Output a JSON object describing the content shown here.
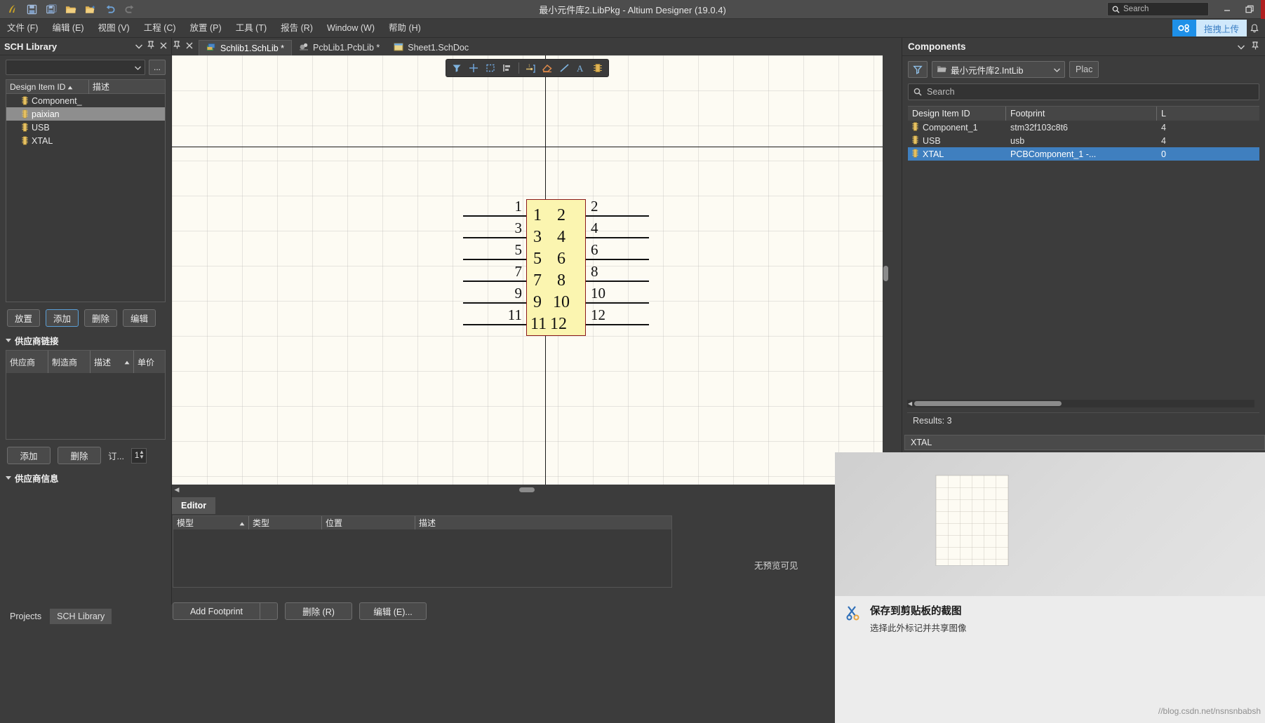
{
  "titlebar": {
    "title": "最小元件库2.LibPkg - Altium Designer (19.0.4)",
    "search_placeholder": "Search",
    "quick_access": [
      "altium-logo",
      "save-icon",
      "save-all-icon",
      "open-icon",
      "open-project-icon",
      "undo-icon",
      "redo-icon"
    ],
    "window_buttons": [
      "minimize",
      "restore",
      "close"
    ]
  },
  "menubar": {
    "items": [
      {
        "label": "文件 (F)"
      },
      {
        "label": "编辑 (E)"
      },
      {
        "label": "视图 (V)"
      },
      {
        "label": "工程 (C)"
      },
      {
        "label": "放置 (P)"
      },
      {
        "label": "工具 (T)"
      },
      {
        "label": "报告 (R)"
      },
      {
        "label": "Window (W)"
      },
      {
        "label": "帮助 (H)"
      }
    ],
    "upload_label": "拖拽上传"
  },
  "left_panel": {
    "title": "SCH Library",
    "library_combo_value": "",
    "dots_label": "...",
    "list_headers": {
      "col1": "Design Item ID",
      "col2": "描述"
    },
    "items": [
      {
        "label": "Component_",
        "selected": false
      },
      {
        "label": "paixian",
        "selected": true
      },
      {
        "label": "USB",
        "selected": false
      },
      {
        "label": "XTAL",
        "selected": false
      }
    ],
    "buttons": [
      {
        "label": "放置",
        "focus": false
      },
      {
        "label": "添加",
        "focus": true
      },
      {
        "label": "删除",
        "focus": false
      },
      {
        "label": "编辑",
        "focus": false
      }
    ],
    "supplier_links": {
      "title": "供应商链接",
      "headers": [
        "供应商",
        "制造商",
        "描述",
        "单价"
      ],
      "rows": []
    },
    "supplier_buttons": [
      {
        "label": "添加"
      },
      {
        "label": "删除"
      }
    ],
    "order_label": "订...",
    "order_qty": "1",
    "supplier_info_title": "供应商信息",
    "bottom_tabs": [
      {
        "label": "Projects",
        "active": false
      },
      {
        "label": "SCH Library",
        "active": true
      }
    ]
  },
  "doc_tabs": [
    {
      "label": "Schlib1.SchLib *",
      "active": true,
      "icon": "schlib-icon"
    },
    {
      "label": "PcbLib1.PcbLib *",
      "active": false,
      "icon": "pcblib-icon"
    },
    {
      "label": "Sheet1.SchDoc",
      "active": false,
      "icon": "schdoc-icon"
    }
  ],
  "canvas": {
    "toolbar_icons": [
      "filter-icon",
      "crosshair-icon",
      "selection-rect-icon",
      "align-icon",
      "place-pin-icon",
      "eraser-icon",
      "line-icon",
      "text-icon",
      "place-part-icon"
    ],
    "symbol": {
      "left_pin_numbers": [
        "1",
        "3",
        "5",
        "7",
        "9",
        "11"
      ],
      "right_pin_numbers": [
        "2",
        "4",
        "6",
        "8",
        "10",
        "12"
      ],
      "inner_left_labels": [
        "1",
        "3",
        "5",
        "7",
        "9",
        "11"
      ],
      "inner_right_labels": [
        "2",
        "4",
        "6",
        "8",
        "10",
        "12"
      ],
      "body_color": "#fbf5b0",
      "body_border_color": "#8b1a1a"
    }
  },
  "editor": {
    "tab_label": "Editor",
    "headers": [
      "模型",
      "类型",
      "位置",
      "描述"
    ],
    "rows": [],
    "no_preview_text": "无预览可见",
    "buttons": {
      "add_footprint": "Add Footprint",
      "delete": "删除 (R)",
      "edit": "编辑 (E)..."
    }
  },
  "right_panel": {
    "title": "Components",
    "library_value": "最小元件库2.IntLib",
    "place_button": "Plac",
    "search_placeholder": "Search",
    "headers": [
      "Design Item ID",
      "Footprint",
      "L"
    ],
    "rows": [
      {
        "design_item_id": "Component_1",
        "footprint": "stm32f103c8t6",
        "extra": "4",
        "selected": false
      },
      {
        "design_item_id": "USB",
        "footprint": "usb",
        "extra": "4",
        "selected": false
      },
      {
        "design_item_id": "XTAL",
        "footprint": "PCBComponent_1 -...",
        "extra": "0",
        "selected": true
      }
    ],
    "results_label": "Results: 3",
    "detail_label": "XTAL"
  },
  "snip_overlay": {
    "title": "保存到剪贴板的截图",
    "subtitle": "选择此外标记并共享图像",
    "watermark": "//blog.csdn.net/nsnsnbabsh"
  },
  "colors": {
    "accent_blue": "#3f7fbf",
    "upload_blue": "#1e90e8",
    "close_red": "#c0392b",
    "canvas_bg": "#fdfbf3"
  }
}
